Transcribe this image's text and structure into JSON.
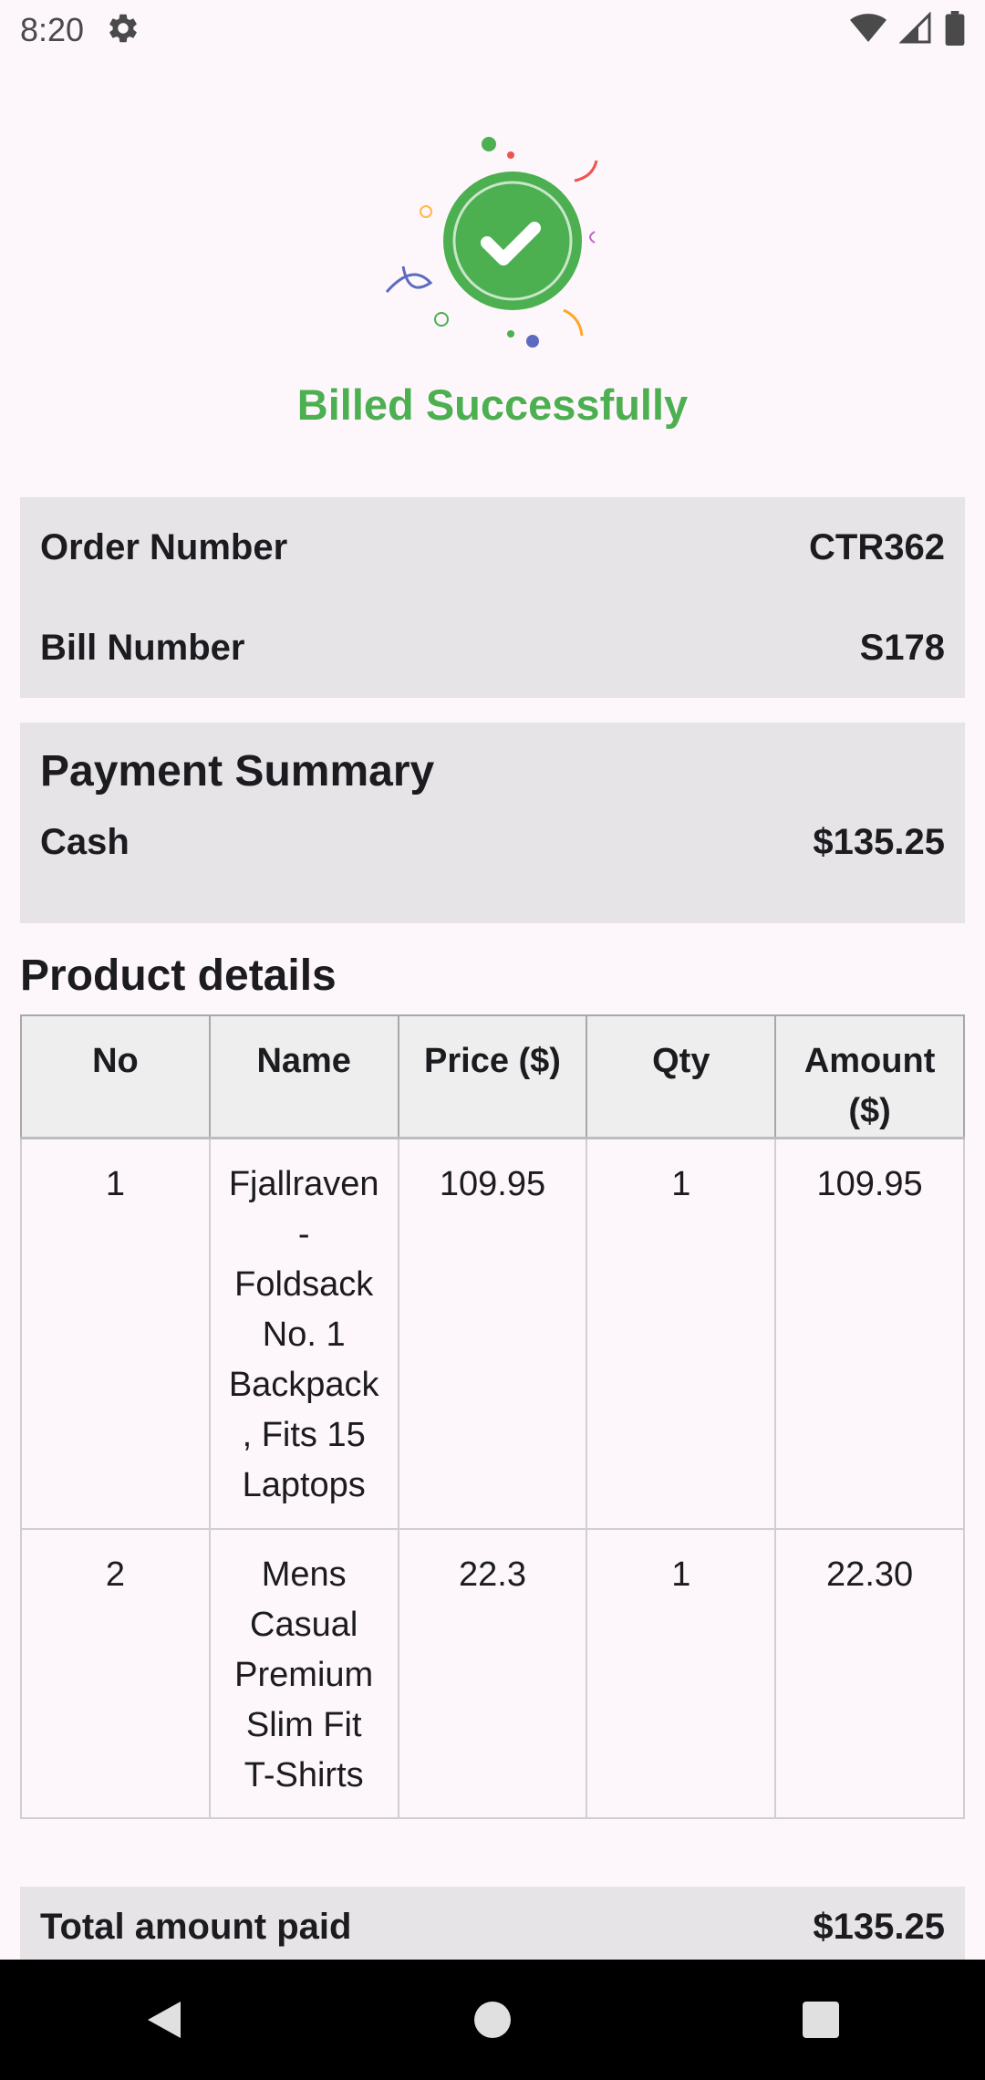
{
  "status_bar": {
    "time": "8:20",
    "settings_icon": "gear-icon",
    "wifi_icon": "wifi-icon",
    "signal_icon": "cell-signal-icon",
    "battery_icon": "battery-icon"
  },
  "hero": {
    "icon": "success-check-icon",
    "accent_color": "#4caf50",
    "title": "Billed Successfully"
  },
  "order_info": {
    "order_number_label": "Order Number",
    "order_number_value": "CTR362",
    "bill_number_label": "Bill Number",
    "bill_number_value": "S178"
  },
  "payment_summary": {
    "heading": "Payment Summary",
    "method_label": "Cash",
    "method_amount": "$135.25"
  },
  "products": {
    "heading": "Product details",
    "columns": [
      "No",
      "Name",
      "Price ($)",
      "Qty",
      "Amount ($)"
    ],
    "rows": [
      {
        "no": "1",
        "name": "Fjallraven - Foldsack No. 1 Backpack, Fits 15 Laptops",
        "price": "109.95",
        "qty": "1",
        "amount": "109.95"
      },
      {
        "no": "2",
        "name": "Mens Casual Premium Slim Fit T-Shirts",
        "price": "22.3",
        "qty": "1",
        "amount": "22.30"
      }
    ]
  },
  "total": {
    "label": "Total amount paid",
    "value": "$135.25"
  },
  "nav_bar": {
    "back_icon": "back-triangle-icon",
    "home_icon": "home-circle-icon",
    "recents_icon": "recents-square-icon"
  }
}
